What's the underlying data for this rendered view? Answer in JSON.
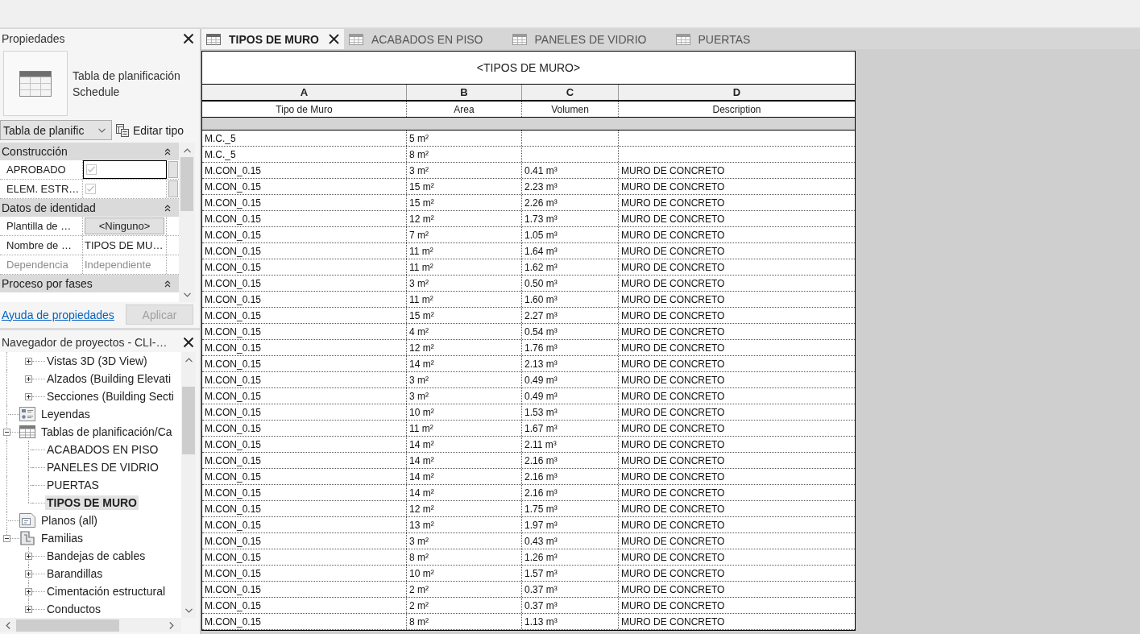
{
  "properties": {
    "title": "Propiedades",
    "type_name": "Tabla de planificación",
    "type_category": "Schedule",
    "type_selector": "Tabla de planific",
    "edit_type_button": "Editar tipo",
    "groups": [
      {
        "title": "Construcción",
        "expanded": true,
        "rows": [
          {
            "kind": "checkbox",
            "name": "APROBADO",
            "checked": true,
            "disabled": false,
            "selected": true
          },
          {
            "kind": "checkbox",
            "name": "ELEM. ESTR…",
            "checked": true,
            "disabled": false,
            "selected": false
          }
        ]
      },
      {
        "title": "Datos de identidad",
        "expanded": true,
        "rows": [
          {
            "kind": "button",
            "name": "Plantilla de …",
            "value": "<Ninguno>",
            "disabled": false,
            "selected": false
          },
          {
            "kind": "text",
            "name": "Nombre de …",
            "value": "TIPOS DE MU…",
            "disabled": false,
            "selected": false
          },
          {
            "kind": "text",
            "name": "Dependencia",
            "value": "Independiente",
            "disabled": true,
            "selected": false
          }
        ]
      },
      {
        "title": "Proceso por fases",
        "expanded": true
      }
    ],
    "help_link": "Ayuda de propiedades",
    "apply_button": {
      "label": "Aplicar",
      "disabled": true
    }
  },
  "project_browser": {
    "title": "Navegador de proyectos - CLI-…",
    "tree": [
      {
        "children": [
          {
            "label": "Vistas 3D (3D View)",
            "expanded": false,
            "selected": false
          },
          {
            "label": "Alzados (Building Elevati",
            "expanded": false,
            "selected": false
          },
          {
            "label": "Secciones (Building Secti",
            "expanded": false,
            "selected": false
          }
        ]
      },
      {
        "kind": "legends",
        "label": "Leyendas",
        "selected": false
      },
      {
        "kind": "schedules",
        "label": "Tablas de planificación/Ca",
        "expanded": true,
        "selected": false,
        "children": [
          {
            "label": "ACABADOS EN PISO",
            "selected": false
          },
          {
            "label": "PANELES DE VIDRIO",
            "selected": false
          },
          {
            "label": "PUERTAS",
            "selected": false
          },
          {
            "label": "TIPOS DE MURO",
            "selected": true
          }
        ]
      },
      {
        "kind": "sheets",
        "label": "Planos (all)",
        "selected": false
      },
      {
        "kind": "families",
        "label": "Familias",
        "expanded": true,
        "selected": false,
        "children": [
          {
            "label": "Bandejas de cables",
            "expanded": false,
            "selected": false
          },
          {
            "label": "Barandillas",
            "expanded": false,
            "selected": false
          },
          {
            "label": "Cimentación estructural",
            "expanded": false,
            "selected": false
          },
          {
            "label": "Conductos",
            "expanded": false,
            "selected": false
          }
        ]
      }
    ]
  },
  "tabs": [
    {
      "label": "TIPOS DE MURO",
      "selected": true
    },
    {
      "label": "ACABADOS EN PISO",
      "selected": false
    },
    {
      "label": "PANELES DE VIDRIO",
      "selected": false
    },
    {
      "label": "PUERTAS",
      "selected": false
    }
  ],
  "schedule": {
    "title": "<TIPOS DE MURO>",
    "columns": [
      {
        "letter": "A",
        "heading": "Tipo de Muro"
      },
      {
        "letter": "B",
        "heading": "Area"
      },
      {
        "letter": "C",
        "heading": "Volumen"
      },
      {
        "letter": "D",
        "heading": "Description"
      }
    ],
    "rows": [
      [
        "M.C._5",
        "5 m²"
      ],
      [
        "M.C._5",
        "8 m²"
      ],
      [
        "M.CON_0.15",
        "3 m²",
        "0.41 m³",
        "MURO DE CONCRETO"
      ],
      [
        "M.CON_0.15",
        "15 m²",
        "2.23 m³",
        "MURO DE CONCRETO"
      ],
      [
        "M.CON_0.15",
        "15 m²",
        "2.26 m³",
        "MURO DE CONCRETO"
      ],
      [
        "M.CON_0.15",
        "12 m²",
        "1.73 m³",
        "MURO DE CONCRETO"
      ],
      [
        "M.CON_0.15",
        "7 m²",
        "1.05 m³",
        "MURO DE CONCRETO"
      ],
      [
        "M.CON_0.15",
        "11 m²",
        "1.64 m³",
        "MURO DE CONCRETO"
      ],
      [
        "M.CON_0.15",
        "11 m²",
        "1.62 m³",
        "MURO DE CONCRETO"
      ],
      [
        "M.CON_0.15",
        "3 m²",
        "0.50 m³",
        "MURO DE CONCRETO"
      ],
      [
        "M.CON_0.15",
        "11 m²",
        "1.60 m³",
        "MURO DE CONCRETO"
      ],
      [
        "M.CON_0.15",
        "15 m²",
        "2.27 m³",
        "MURO DE CONCRETO"
      ],
      [
        "M.CON_0.15",
        "4 m²",
        "0.54 m³",
        "MURO DE CONCRETO"
      ],
      [
        "M.CON_0.15",
        "12 m²",
        "1.76 m³",
        "MURO DE CONCRETO"
      ],
      [
        "M.CON_0.15",
        "14 m²",
        "2.13 m³",
        "MURO DE CONCRETO"
      ],
      [
        "M.CON_0.15",
        "3 m²",
        "0.49 m³",
        "MURO DE CONCRETO"
      ],
      [
        "M.CON_0.15",
        "3 m²",
        "0.49 m³",
        "MURO DE CONCRETO"
      ],
      [
        "M.CON_0.15",
        "10 m²",
        "1.53 m³",
        "MURO DE CONCRETO"
      ],
      [
        "M.CON_0.15",
        "11 m²",
        "1.67 m³",
        "MURO DE CONCRETO"
      ],
      [
        "M.CON_0.15",
        "14 m²",
        "2.11 m³",
        "MURO DE CONCRETO"
      ],
      [
        "M.CON_0.15",
        "14 m²",
        "2.16 m³",
        "MURO DE CONCRETO"
      ],
      [
        "M.CON_0.15",
        "14 m²",
        "2.16 m³",
        "MURO DE CONCRETO"
      ],
      [
        "M.CON_0.15",
        "14 m²",
        "2.16 m³",
        "MURO DE CONCRETO"
      ],
      [
        "M.CON_0.15",
        "12 m²",
        "1.75 m³",
        "MURO DE CONCRETO"
      ],
      [
        "M.CON_0.15",
        "13 m²",
        "1.97 m³",
        "MURO DE CONCRETO"
      ],
      [
        "M.CON_0.15",
        "3 m²",
        "0.43 m³",
        "MURO DE CONCRETO"
      ],
      [
        "M.CON_0.15",
        "8 m²",
        "1.26 m³",
        "MURO DE CONCRETO"
      ],
      [
        "M.CON_0.15",
        "10 m²",
        "1.57 m³",
        "MURO DE CONCRETO"
      ],
      [
        "M.CON_0.15",
        "2 m²",
        "0.37 m³",
        "MURO DE CONCRETO"
      ],
      [
        "M.CON_0.15",
        "2 m²",
        "0.37 m³",
        "MURO DE CONCRETO"
      ],
      [
        "M.CON_0.15",
        "8 m²",
        "1.13 m³",
        "MURO DE CONCRETO"
      ]
    ]
  }
}
